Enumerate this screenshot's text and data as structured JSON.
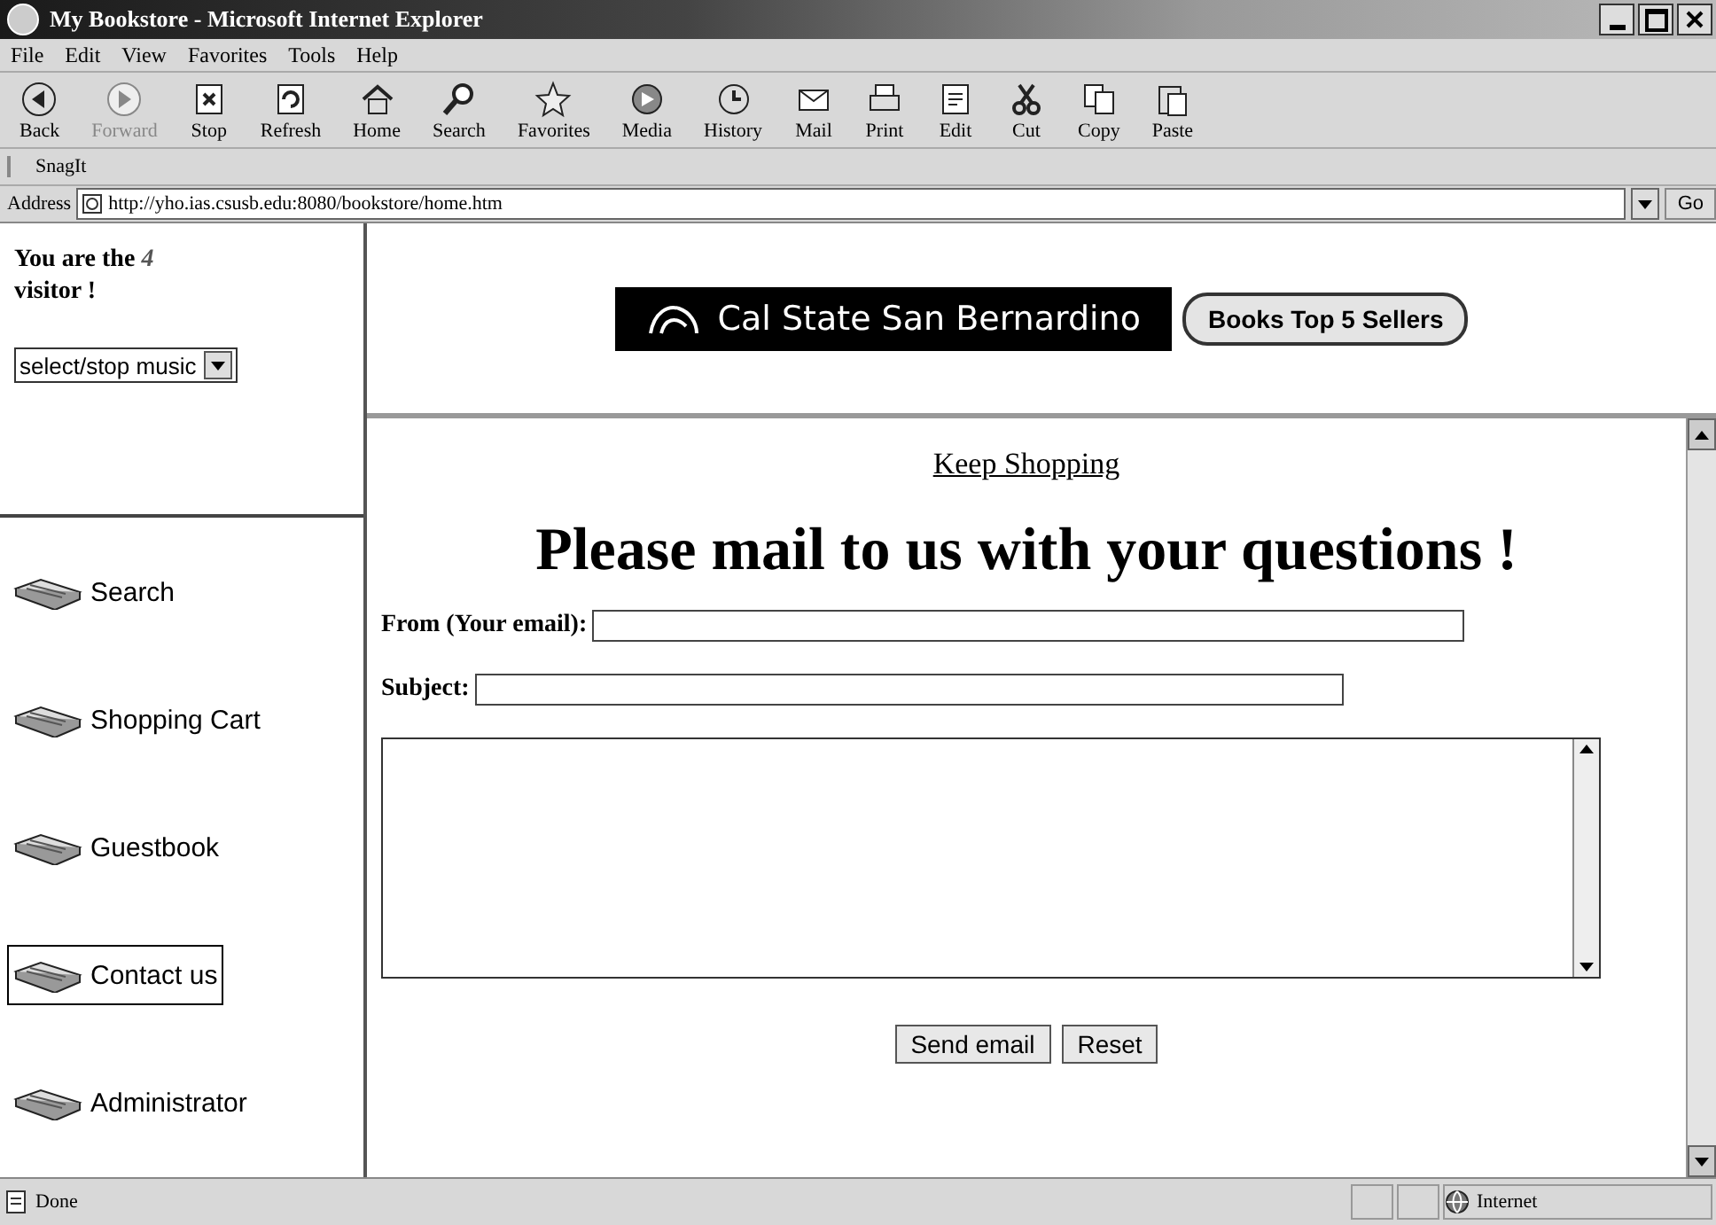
{
  "window": {
    "title": "My Bookstore - Microsoft Internet Explorer"
  },
  "menu": [
    "File",
    "Edit",
    "View",
    "Favorites",
    "Tools",
    "Help"
  ],
  "toolbar": [
    {
      "label": "Back",
      "kind": "back"
    },
    {
      "label": "Forward",
      "kind": "forward"
    },
    {
      "label": "Stop",
      "kind": "stop"
    },
    {
      "label": "Refresh",
      "kind": "refresh"
    },
    {
      "label": "Home",
      "kind": "home"
    },
    {
      "label": "Search",
      "kind": "search"
    },
    {
      "label": "Favorites",
      "kind": "star"
    },
    {
      "label": "Media",
      "kind": "media"
    },
    {
      "label": "History",
      "kind": "history"
    },
    {
      "label": "Mail",
      "kind": "mail"
    },
    {
      "label": "Print",
      "kind": "print"
    },
    {
      "label": "Edit",
      "kind": "edit"
    },
    {
      "label": "Cut",
      "kind": "cut"
    },
    {
      "label": "Copy",
      "kind": "copy"
    },
    {
      "label": "Paste",
      "kind": "paste"
    }
  ],
  "snagit_bar": {
    "label": "SnagIt"
  },
  "address_bar": {
    "label": "Address",
    "url": "http://yho.ias.csusb.edu:8080/bookstore/home.htm",
    "go": "Go"
  },
  "sidebar": {
    "counter_before": "You are the",
    "counter": "4",
    "counter_after": "visitor !",
    "music_select": "select/stop music",
    "items": [
      {
        "label": "Search",
        "selected": false
      },
      {
        "label": "Shopping Cart",
        "selected": false
      },
      {
        "label": "Guestbook",
        "selected": false
      },
      {
        "label": "Contact us",
        "selected": true
      },
      {
        "label": "Administrator",
        "selected": false
      }
    ]
  },
  "banner": {
    "logo": "Cal State San Bernardino",
    "button": "Books Top 5 Sellers"
  },
  "content": {
    "link": "Keep Shopping",
    "heading": "Please mail to us with your questions !",
    "fields": [
      {
        "label": "From (Your email):"
      },
      {
        "label": "Subject:"
      }
    ],
    "buttons": [
      "Send email",
      "Reset"
    ]
  },
  "status_bar": {
    "text": "Done",
    "zone": "Internet"
  }
}
